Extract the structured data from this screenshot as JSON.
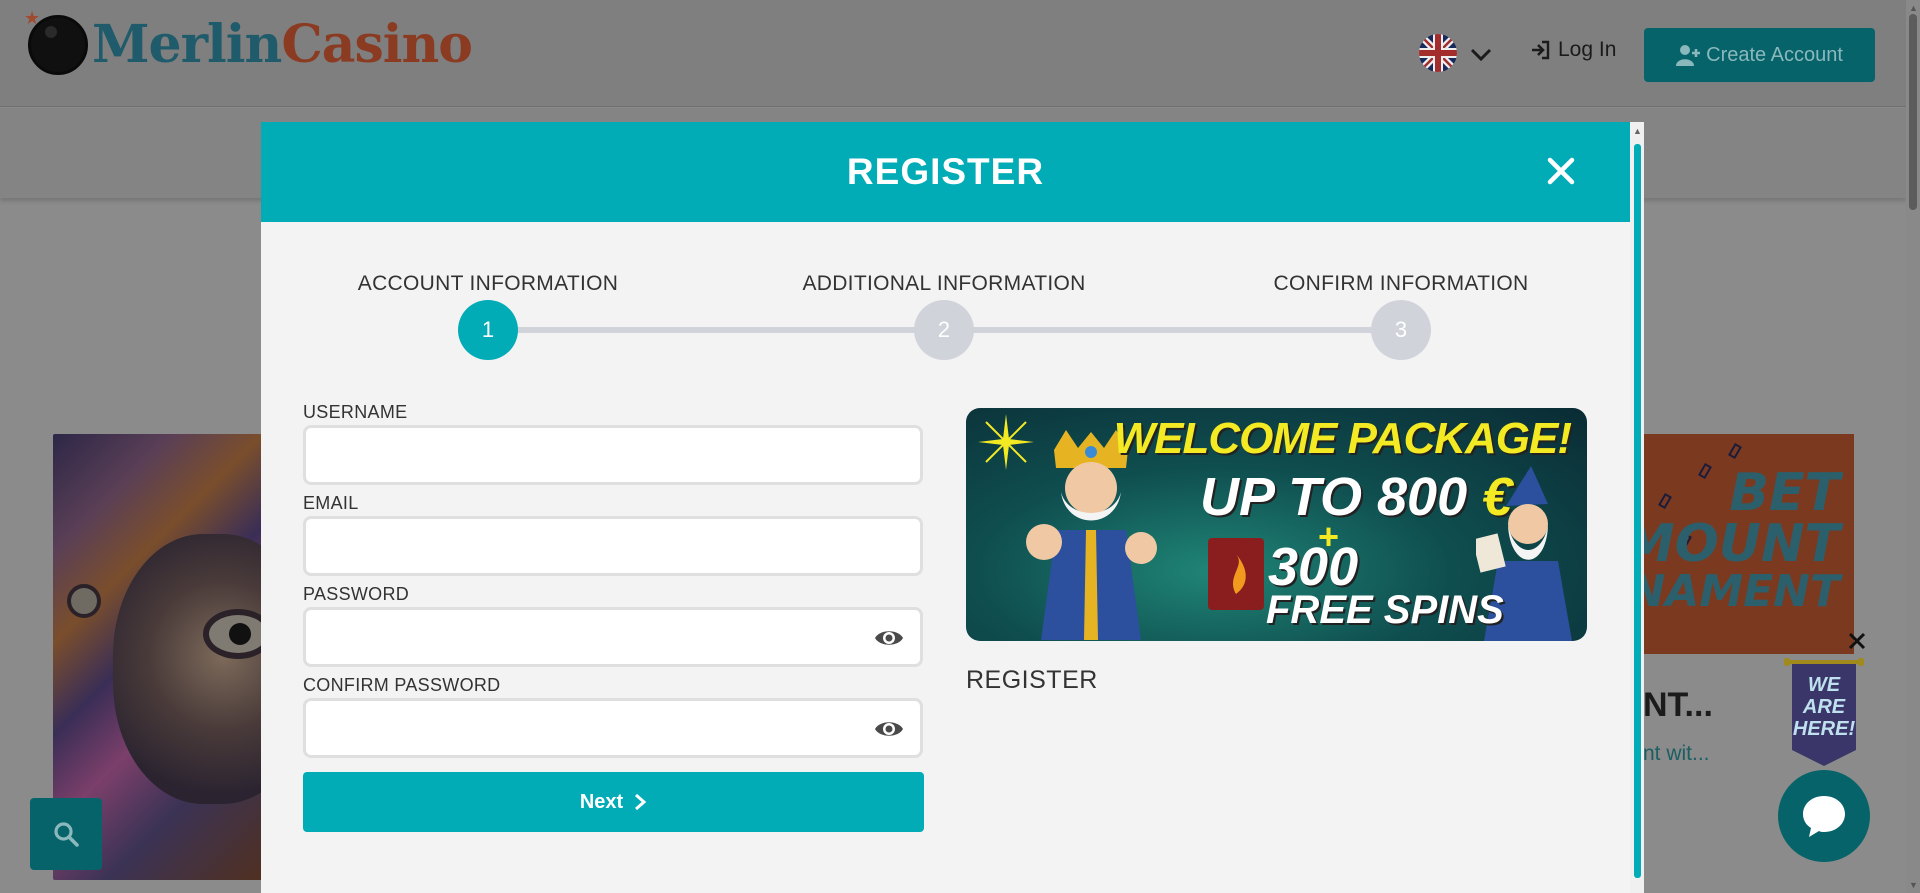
{
  "header": {
    "logo_part1": "Merlin",
    "logo_part2": "Casino",
    "login_label": "Log In",
    "create_account_label": "Create Account"
  },
  "background": {
    "card_right_line1": "BET",
    "card_right_line2": "MOUNT",
    "card_right_line3": "RNAMENT",
    "card_right_title": "NT...",
    "card_right_subtitle": "nt wit...",
    "chat_banner_text": "WE ARE HERE!"
  },
  "modal": {
    "title": "REGISTER",
    "steps": [
      {
        "label": "ACCOUNT INFORMATION",
        "number": "1",
        "active": true
      },
      {
        "label": "ADDITIONAL INFORMATION",
        "number": "2",
        "active": false
      },
      {
        "label": "CONFIRM INFORMATION",
        "number": "3",
        "active": false
      }
    ],
    "fields": {
      "username_label": "USERNAME",
      "username_value": "",
      "email_label": "EMAIL",
      "email_value": "",
      "password_label": "PASSWORD",
      "password_value": "",
      "confirm_password_label": "CONFIRM PASSWORD",
      "confirm_password_value": ""
    },
    "next_label": "Next",
    "promo": {
      "headline": "WELCOME PACKAGE!",
      "line2": "UP TO 800",
      "currency": "€",
      "plus": "+",
      "line3": "300",
      "line4": "FREE SPINS"
    },
    "register_label": "REGISTER"
  },
  "colors": {
    "accent": "#02acb7",
    "accent_dark": "#06636a",
    "step_inactive": "#d0d4da",
    "promo_yellow": "#f3ea24"
  }
}
